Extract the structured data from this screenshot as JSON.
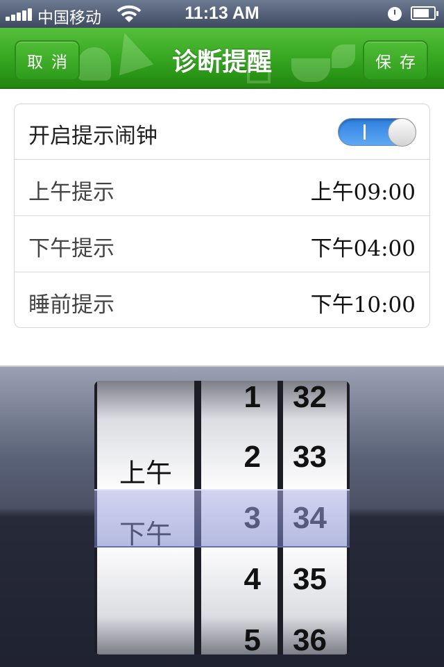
{
  "status_bar": {
    "carrier": "中国移动",
    "time": "11:13 AM",
    "icons": [
      "signal-icon",
      "wifi-icon",
      "alarm-icon",
      "battery-icon"
    ]
  },
  "nav": {
    "title": "诊断提醒",
    "cancel_label": "取消",
    "save_label": "保存"
  },
  "settings": {
    "alarm_label": "开启提示闹钟",
    "alarm_toggle_mark": "I",
    "alarm_enabled": true,
    "rows": [
      {
        "label": "上午提示",
        "value": "上午09:00"
      },
      {
        "label": "下午提示",
        "value": "下午04:00"
      },
      {
        "label": "睡前提示",
        "value": "下午10:00"
      }
    ]
  },
  "picker": {
    "ampm": [
      "上午",
      "下午"
    ],
    "hours": [
      "1",
      "2",
      "3",
      "4",
      "5"
    ],
    "minutes": [
      "32",
      "33",
      "34",
      "35",
      "36"
    ],
    "selected": {
      "ampm": "下午",
      "hour": "3",
      "minute": "34"
    }
  },
  "colors": {
    "nav_green": "#33a51f",
    "toggle_blue": "#2e7fe0",
    "status_bar": "#4a5670"
  }
}
